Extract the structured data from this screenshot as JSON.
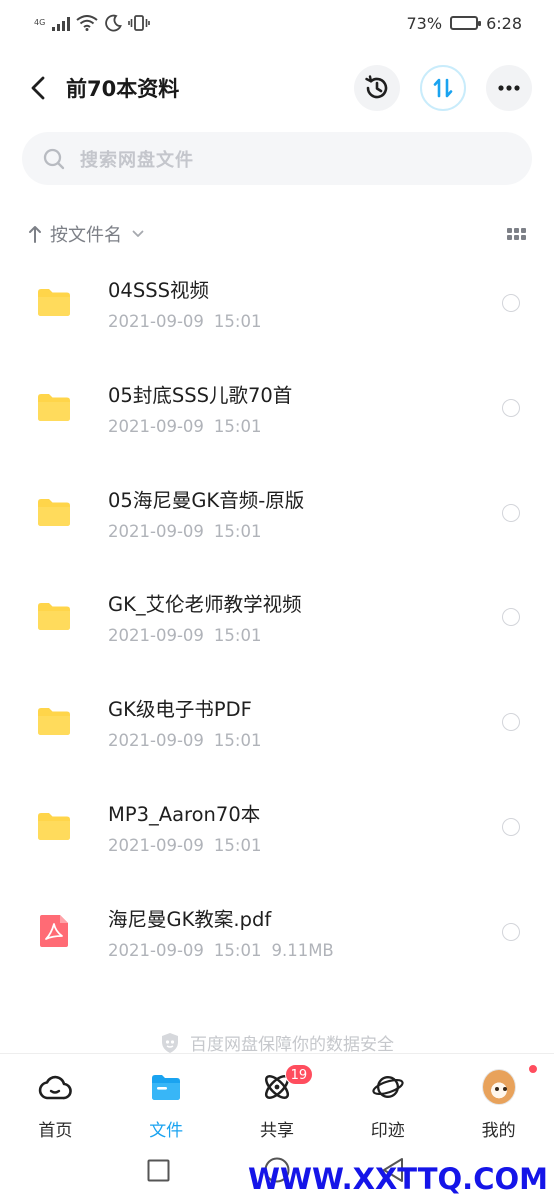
{
  "status_bar": {
    "network_label": "4G",
    "battery_percent": "73%",
    "battery_level": 0.73,
    "time": "6:28"
  },
  "header": {
    "title": "前70本资料",
    "back_icon": "chevron-left-icon",
    "history_icon": "history-icon",
    "transfer_icon": "transfer-icon",
    "more_icon": "more-icon"
  },
  "search": {
    "placeholder": "搜索网盘文件"
  },
  "sort": {
    "label": "按文件名"
  },
  "files": [
    {
      "name": "04SSS视频",
      "date": "2021-09-09",
      "time": "15:01",
      "size": "",
      "type": "folder"
    },
    {
      "name": "05封底SSS儿歌70首",
      "date": "2021-09-09",
      "time": "15:01",
      "size": "",
      "type": "folder"
    },
    {
      "name": "05海尼曼GK音频-原版",
      "date": "2021-09-09",
      "time": "15:01",
      "size": "",
      "type": "folder"
    },
    {
      "name": "GK_艾伦老师教学视频",
      "date": "2021-09-09",
      "time": "15:01",
      "size": "",
      "type": "folder"
    },
    {
      "name": "GK级电子书PDF",
      "date": "2021-09-09",
      "time": "15:01",
      "size": "",
      "type": "folder"
    },
    {
      "name": "MP3_Aaron70本",
      "date": "2021-09-09",
      "time": "15:01",
      "size": "",
      "type": "folder"
    },
    {
      "name": "海尼曼GK教案.pdf",
      "date": "2021-09-09",
      "time": "15:01",
      "size": "9.11MB",
      "type": "pdf"
    }
  ],
  "safety_note": "百度网盘保障你的数据安全",
  "tabs": [
    {
      "label": "首页"
    },
    {
      "label": "文件"
    },
    {
      "label": "共享",
      "badge": "19"
    },
    {
      "label": "印迹"
    },
    {
      "label": "我的"
    }
  ],
  "active_tab": "文件",
  "watermark": "WWW.XXTTQ.COM",
  "colors": {
    "accent": "#1aa3f0",
    "folder": "#ffd54a",
    "pdf": "#ff6b75",
    "badge": "#ff4d5e"
  }
}
